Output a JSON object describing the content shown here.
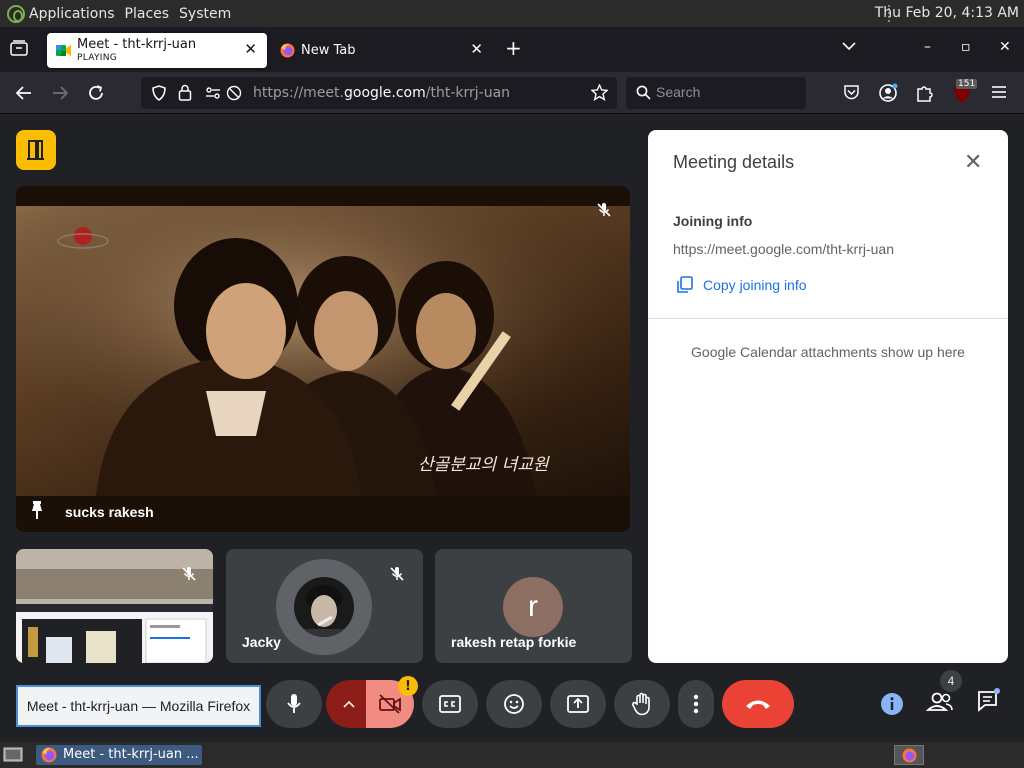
{
  "system_panel": {
    "menus": [
      "Applications",
      "Places",
      "System"
    ],
    "clock": "Thu Feb 20,  4:13 AM"
  },
  "browser": {
    "tabs": [
      {
        "title": "Meet - tht-krrj-uan",
        "subtitle": "PLAYING",
        "close": "✕",
        "active": true
      },
      {
        "title": "New Tab",
        "close": "✕",
        "active": false
      }
    ],
    "new_tab": "+",
    "url_prefix": "https://meet.",
    "url_domain": "google.com",
    "url_path": "/tht-krrj-uan",
    "search_placeholder": "Search",
    "extension_badge": "151",
    "window_controls": {
      "minimize": "–",
      "maximize": "▫",
      "close": "✕"
    }
  },
  "meet": {
    "main_tile": {
      "name": "sucks rakesh",
      "caption": "산골분교의 녀교원"
    },
    "tiles": [
      {
        "name": "",
        "muted": true
      },
      {
        "name": "Jacky",
        "muted": true
      },
      {
        "name": "rakesh retap forkie",
        "avatar_letter": "r"
      }
    ],
    "details": {
      "title": "Meeting details",
      "close": "✕",
      "joining_label": "Joining info",
      "link": "https://meet.google.com/tht-krrj-uan",
      "copy_label": "Copy joining info",
      "calendar_note": "Google Calendar attachments show up here"
    },
    "tooltip": "Meet - tht-krrj-uan — Mozilla Firefox",
    "camera_warning": "!",
    "people_count": "4"
  },
  "taskbar": {
    "task_title": "Meet - tht-krrj-uan ..."
  },
  "colors": {
    "meet_bg": "#202124",
    "leave_red": "#ea4335",
    "cam_off": "#f28b82",
    "accent_blue": "#8ab4f8",
    "link_blue": "#1a73e8",
    "yellow": "#fbbc04"
  }
}
